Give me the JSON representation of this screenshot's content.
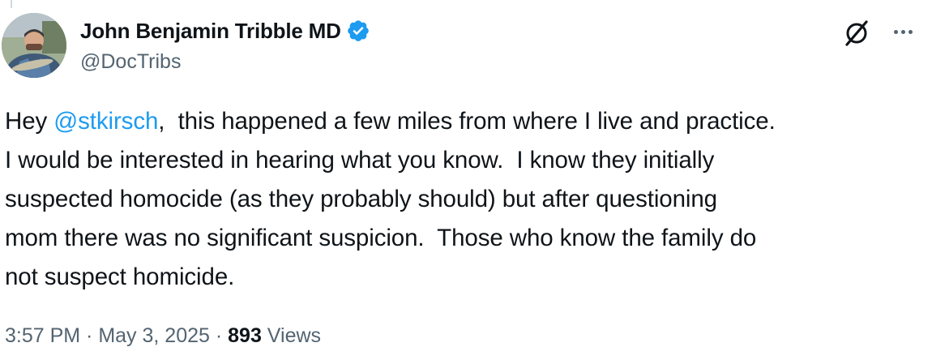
{
  "author": {
    "display_name": "John Benjamin Tribble MD",
    "handle": "@DocTribs",
    "verified_color": "#1d9bf0"
  },
  "actions": {
    "grok_icon": "grok-icon",
    "more_icon": "more-options-icon"
  },
  "tweet": {
    "line1_prefix": "Hey ",
    "mention": "@stkirsch",
    "line1_suffix": ",  this happened a few miles from where I live and practice.",
    "line2": "I would be interested in hearing what you know.  I know they initially",
    "line3": "suspected homocide (as they probably should) but after questioning",
    "line4": "mom there was no significant suspicion.  Those who know the family do",
    "line5": "not suspect homicide."
  },
  "meta": {
    "time": "3:57 PM",
    "date": "May 3, 2025",
    "separator": " · ",
    "views_count": "893",
    "views_label": " Views"
  },
  "colors": {
    "text": "#0f1419",
    "secondary": "#536471",
    "accent": "#1d9bf0"
  }
}
